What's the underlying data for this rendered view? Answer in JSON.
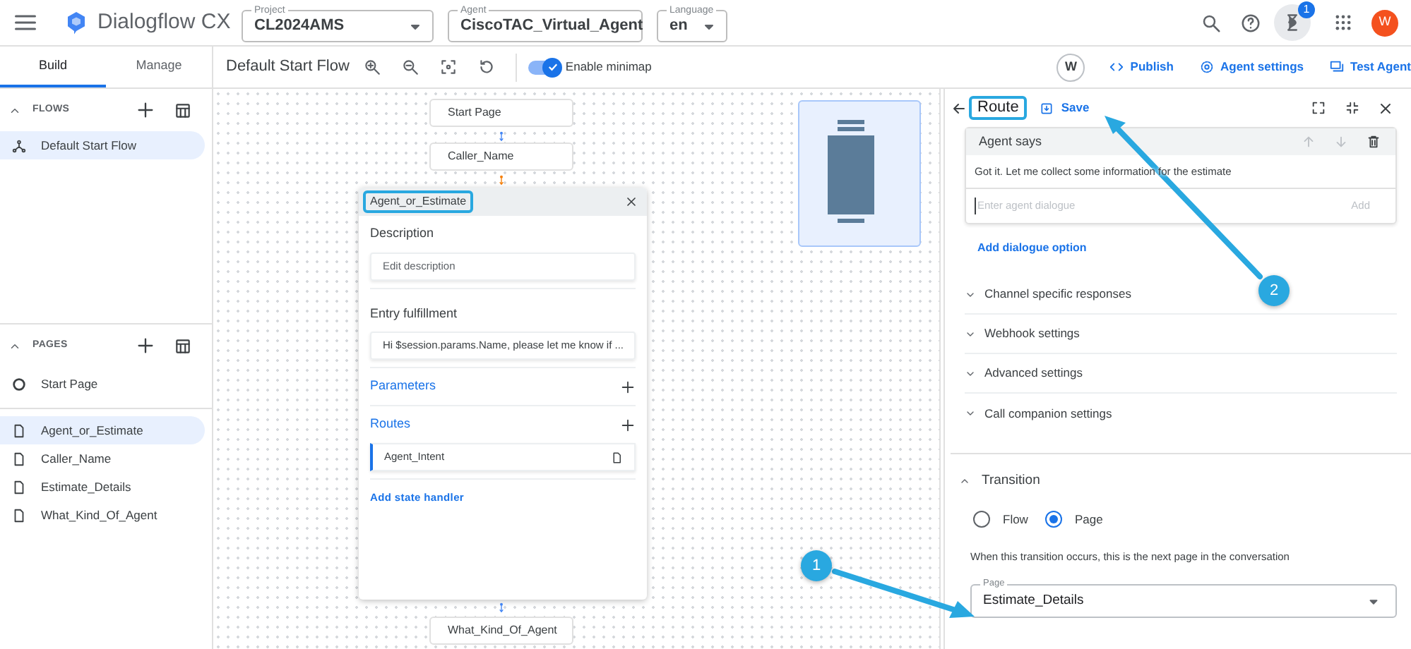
{
  "app": {
    "name": "Dialogflow CX"
  },
  "selectors": [
    {
      "label": "Project",
      "value": "CL2024AMS"
    },
    {
      "label": "Agent",
      "value": "CiscoTAC_Virtual_Agent"
    },
    {
      "label": "Language",
      "value": "en"
    }
  ],
  "notifications": {
    "count": "1"
  },
  "user": {
    "initial": "W"
  },
  "side_tabs": [
    {
      "label": "Build",
      "selected": true
    },
    {
      "label": "Manage",
      "selected": false
    }
  ],
  "toolbar": {
    "title": "Default Start Flow",
    "minimap": {
      "label": "Enable minimap",
      "on": true
    },
    "collaborator": "W",
    "actions": [
      {
        "kind": "code",
        "label": "Publish"
      },
      {
        "kind": "gear",
        "label": "Agent settings"
      },
      {
        "kind": "chat",
        "label": "Test Agent"
      }
    ]
  },
  "flows": {
    "title": "FLOWS",
    "items": [
      {
        "label": "Default Start Flow",
        "selected": true
      }
    ]
  },
  "pages": {
    "title": "PAGES",
    "items": [
      {
        "label": "Start Page",
        "kind": "start",
        "selected": false
      },
      {
        "label": "Agent_or_Estimate",
        "kind": "page",
        "selected": true
      },
      {
        "label": "Caller_Name",
        "kind": "page",
        "selected": false
      },
      {
        "label": "Estimate_Details",
        "kind": "page",
        "selected": false
      },
      {
        "label": "What_Kind_Of_Agent",
        "kind": "page",
        "selected": false
      }
    ]
  },
  "canvas": {
    "nodes": [
      {
        "label": "Start Page"
      },
      {
        "label": "Caller_Name"
      }
    ],
    "page_card": {
      "title": "Agent_or_Estimate",
      "description_label": "Description",
      "description_placeholder": "Edit description",
      "fulfillment_label": "Entry fulfillment",
      "fulfillment": "Hi $session.params.Name, please let me know if ...",
      "parameters": "Parameters",
      "routes": "Routes",
      "route": "Agent_Intent",
      "add_handler": "Add state handler"
    },
    "bottom_node": {
      "label": "What_Kind_Of_Agent"
    }
  },
  "route_panel": {
    "title": "Route",
    "save": "Save",
    "agent_says": {
      "title": "Agent says",
      "message": "Got it. Let me collect some information for the estimate",
      "placeholder": "Enter agent dialogue",
      "add": "Add"
    },
    "add_option": "Add dialogue option",
    "sections": [
      {
        "label": "Channel specific responses",
        "expanded": false
      },
      {
        "label": "Webhook settings",
        "expanded": false
      },
      {
        "label": "Advanced settings",
        "expanded": false
      },
      {
        "label": "Call companion settings",
        "expanded": false
      }
    ],
    "transition": {
      "label": "Transition",
      "expanded": true,
      "options": [
        {
          "label": "Flow",
          "selected": false
        },
        {
          "label": "Page",
          "selected": true
        }
      ],
      "hint": "When this transition occurs, this is the next page in the conversation",
      "field_label": "Page",
      "value": "Estimate_Details"
    }
  },
  "callouts": [
    {
      "number": "1"
    },
    {
      "number": "2"
    }
  ]
}
